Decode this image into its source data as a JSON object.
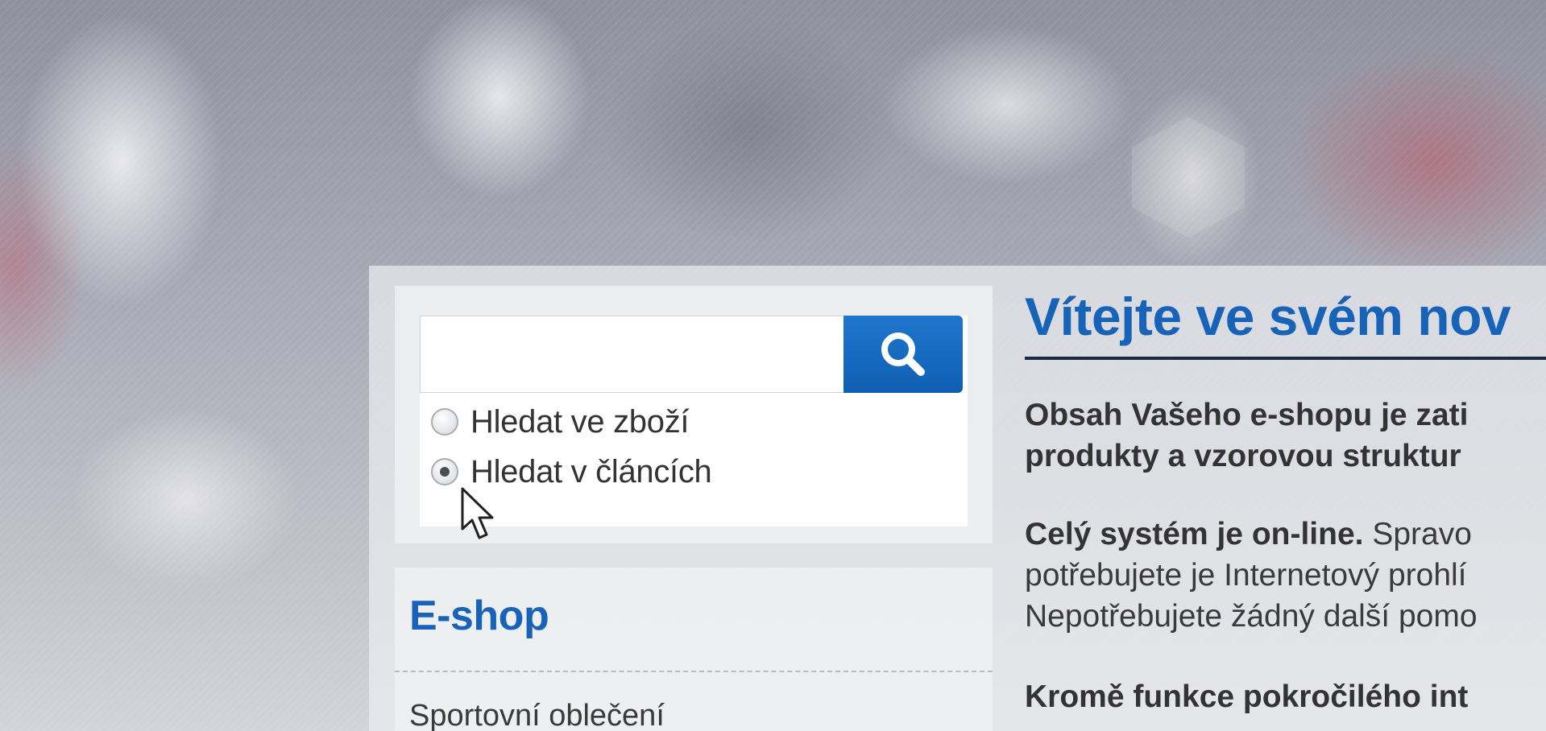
{
  "search": {
    "input_value": "",
    "button_label": "Hledat",
    "options": [
      {
        "label": "Hledat ve zboží",
        "checked": false
      },
      {
        "label": "Hledat v článcích",
        "checked": true
      }
    ]
  },
  "sidebar": {
    "eshop_title": "E-shop",
    "items": [
      "Sportovní oblečení"
    ]
  },
  "main": {
    "title": "Vítejte ve svém nov",
    "para1_lines": [
      "Obsah Vašeho e-shopu je zati",
      "produkty a vzorovou struktur"
    ],
    "para2_bold": "Celý systém je on-line.",
    "para2_rest": " Spravo",
    "para2_lines": [
      "potřebujete je Internetový prohlí",
      "Nepotřebujete žádný další pomo"
    ],
    "para3_bold": "Kromě funkce pokročilého int"
  },
  "colors": {
    "accent": "#1763b8",
    "button": "#1668c1",
    "text": "#333333"
  },
  "icons": {
    "search_button": "search-icon",
    "pointer": "mouse-pointer-icon"
  }
}
